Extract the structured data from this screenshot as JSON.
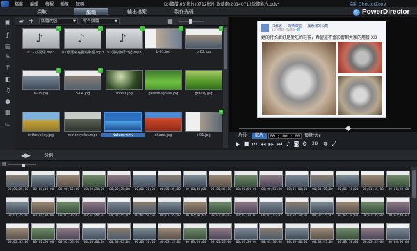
{
  "menu": {
    "items": [
      "檔案",
      "編輯",
      "檢視",
      "播放",
      "說明"
    ],
    "title": "D:\\體僧\\03\\影片\\0712影片 說使劇\\20140712說體影片.pdv*",
    "help_link": "協助 DirectorZone"
  },
  "modes": {
    "tabs": [
      "擷取",
      "編輯",
      "輸出檔案",
      "製作光碟"
    ],
    "active": "編輯"
  },
  "brand": {
    "name": "PowerDirector",
    "accent": "#3b6fb5"
  },
  "library_toolbar": {
    "combo1": "媒體內容",
    "combo2": "所有媒體",
    "icons": [
      "import-media-icon",
      "plugin-icon",
      "grid-view-icon",
      "zoom-slider"
    ]
  },
  "library": {
    "items": [
      {
        "label": "02 - 小愛情.mp3",
        "kind": "music",
        "used": true
      },
      {
        "label": "03.很遙寫在我的歌裡.mp3",
        "kind": "music",
        "used": true
      },
      {
        "label": "03愛的旅行日記.mp3",
        "kind": "music",
        "used": true
      },
      {
        "label": "b-01.jpg",
        "kind": "photo",
        "used": true
      },
      {
        "label": "b-02.jpg",
        "kind": "photo",
        "used": true
      },
      {
        "label": "b-03.jpg",
        "kind": "photo",
        "used": true
      },
      {
        "label": "b-04.jpg",
        "kind": "photo",
        "used": true
      },
      {
        "label": "forest.jpg",
        "kind": "forest",
        "used": false
      },
      {
        "label": "gelenhegrass.jpg",
        "kind": "grass",
        "used": false
      },
      {
        "label": "grassy.jpg",
        "kind": "grassy",
        "used": false
      },
      {
        "label": "inthevalley.jpg",
        "kind": "valley",
        "used": false
      },
      {
        "label": "motorcycles.mpo",
        "kind": "moto",
        "used": false
      },
      {
        "label": "Nature.wmv",
        "kind": "nature",
        "used": false
      },
      {
        "label": "shade.jpg",
        "kind": "shade",
        "used": false
      },
      {
        "label": "t-01.jpg",
        "kind": "photo",
        "used": true
      }
    ]
  },
  "preview": {
    "post_name": "江蘇省 ⋯ 媒樂總監 ⋯ 厲惠滿的公司",
    "post_meta": "17小時前 · Yuetin · 🌐",
    "post_text": "她的特殊癖好是愛吃的鞋袜，希望這不會影響到大家的用餐 XD",
    "clip_mode_label": "片段",
    "movie_mode_label": "影片",
    "active_mode": "影片",
    "timecode": "00 ; 00 ; 00 . 05",
    "quality": "預覽/大小"
  },
  "middle": {
    "tab_label": "分割"
  },
  "storyboard": {
    "rows": [
      [
        "00;00;05;00",
        "00;00;10;00",
        "00;00;15;00",
        "00;00;20;00",
        "00;00;25;00",
        "00;00;30;00",
        "00;00;35;00",
        "00;00;40;00",
        "00;00;45;00",
        "00;00;50;00",
        "00;00;55;00",
        "00;01;00;00",
        "00;01;05;00",
        "00;01;10;00",
        "00;01;15;00",
        "00;01;20;00"
      ],
      [
        "00;01;25;00",
        "00;01;30;00",
        "00;01;35;02",
        "00;01;40;02",
        "00;01;45;02",
        "00;01;50;02",
        "00;01;55;02",
        "00;02;00;02",
        "00;02;05;02",
        "00;02;10;02",
        "00;02;15;02",
        "00;02;20;02",
        "00;02;25;02",
        "00;02;30;02",
        "00;02;35;02",
        "00;02;40;02"
      ],
      [
        "00;02;45;00",
        "00;02;50;00",
        "00;02;55;04",
        "00;03;00;04",
        "00;03;05;04",
        "00;03;10;04",
        "00;03;15;04",
        "00;03;20;04",
        "00;03;25;04",
        "00;03;30;04",
        "00;03;35;04",
        "00;03;40;04",
        "00;03;45;04",
        "00;03;50;04",
        "00;03;55;04",
        "00;04;00;04"
      ]
    ]
  }
}
